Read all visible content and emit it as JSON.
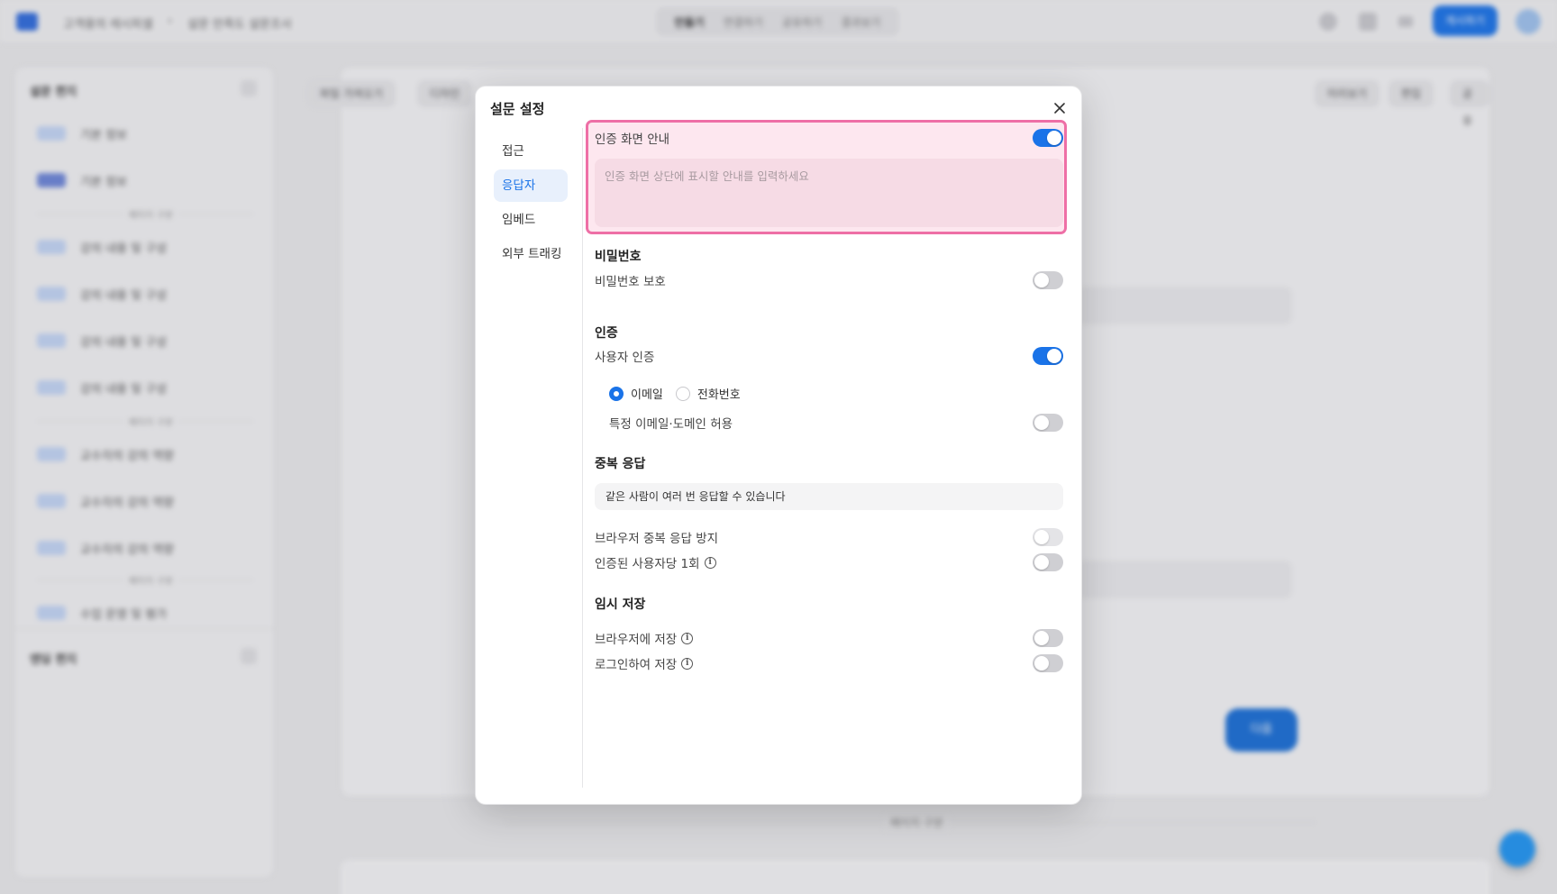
{
  "background": {
    "breadcrumb": [
      "고객용의 레시피셀",
      "설문 만족도 설문조사"
    ],
    "tabs": [
      "만들기",
      "연결하기",
      "공유하기",
      "결과보기"
    ],
    "primary_button": "게시하기",
    "sidebar": {
      "header": "설문 편지",
      "footer_header": "엔딩 편지",
      "items": [
        {
          "label": "기본 정보"
        },
        {
          "label": "기본 정보"
        },
        {
          "label": "강의 내용 및 구성"
        },
        {
          "label": "강의 내용 및 구성"
        },
        {
          "label": "강의 내용 및 구성"
        },
        {
          "label": "강의 내용 및 구성"
        },
        {
          "label": "교수자의 강의 역량"
        },
        {
          "label": "교수자의 강의 역량"
        },
        {
          "label": "교수자의 강의 역량"
        },
        {
          "label": "수업 운영 및 평가"
        }
      ],
      "separators": [
        "페이지 구분",
        "페이지 구분",
        "페이지 구분"
      ]
    },
    "main": {
      "toolbar_left": [
        "파일 가져오기",
        "디자인"
      ],
      "toolbar_right": [
        "미리보기",
        "편집",
        "공유"
      ],
      "fab_label": "다음",
      "caption": "페이지 구분"
    }
  },
  "modal": {
    "title": "설문 설정",
    "nav": [
      {
        "label": "접근",
        "active": false
      },
      {
        "label": "응답자",
        "active": true
      },
      {
        "label": "임베드",
        "active": false
      },
      {
        "label": "외부 트래킹",
        "active": false
      }
    ],
    "auth_notice": {
      "label": "인증 화면 안내",
      "enabled": true,
      "placeholder": "인증 화면 상단에 표시할 안내를 입력하세요"
    },
    "password": {
      "section_title": "비밀번호",
      "protect_label": "비밀번호 보호",
      "protect_enabled": false
    },
    "auth": {
      "section_title": "인증",
      "user_auth_label": "사용자 인증",
      "user_auth_enabled": true,
      "methods": [
        {
          "label": "이메일",
          "selected": true
        },
        {
          "label": "전화번호",
          "selected": false
        }
      ],
      "allow_domain_label": "특정 이메일·도메인 허용",
      "allow_domain_enabled": false
    },
    "duplicate": {
      "section_title": "중복 응답",
      "note": "같은 사람이 여러 번 응답할 수 있습니다",
      "browser_prevent_label": "브라우저 중복 응답 방지",
      "browser_prevent_enabled": false,
      "per_user_label": "인증된 사용자당 1회",
      "per_user_enabled": false
    },
    "draft": {
      "section_title": "임시 저장",
      "browser_save_label": "브라우저에 저장",
      "browser_save_enabled": false,
      "login_save_label": "로그인하여 저장",
      "login_save_enabled": false
    }
  },
  "colors": {
    "accent": "#1a73e8",
    "highlight_border": "#ee6fa6",
    "highlight_fill": "#fde7ef"
  }
}
